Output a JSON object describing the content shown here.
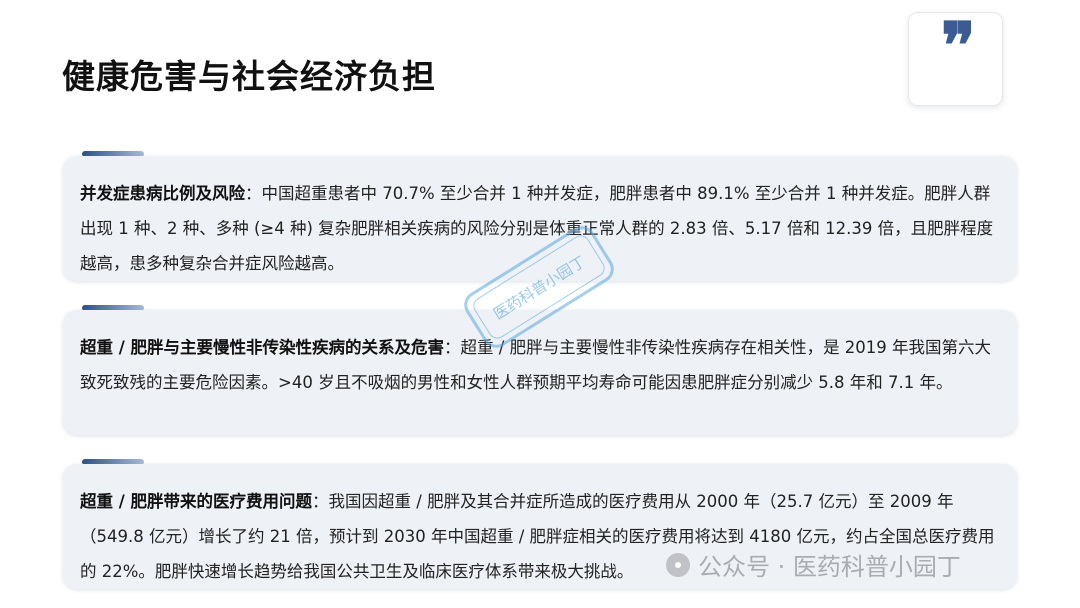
{
  "page_title": "健康危害与社会经济负担",
  "quote_symbol": "❞",
  "sections": [
    {
      "heading": "并发症患病比例及风险",
      "body": "：中国超重患者中 70.7% 至少合并 1 种并发症，肥胖患者中 89.1% 至少合并 1 种并发症。肥胖人群出现 1 种、2 种、多种 (≥4 种) 复杂肥胖相关疾病的风险分别是体重正常人群的 2.83 倍、5.17 倍和 12.39 倍，且肥胖程度越高，患多种复杂合并症风险越高。"
    },
    {
      "heading": "超重 / 肥胖与主要慢性非传染性疾病的关系及危害",
      "body": "：超重 / 肥胖与主要慢性非传染性疾病存在相关性，是 2019 年我国第六大致死致残的主要危险因素。>40 岁且不吸烟的男性和女性人群预期平均寿命可能因患肥胖症分别减少 5.8 年和 7.1 年。"
    },
    {
      "heading": "超重 / 肥胖带来的医疗费用问题",
      "body": "：我国因超重 / 肥胖及其合并症所造成的医疗费用从 2000 年（25.7 亿元）至 2009 年（549.8 亿元）增长了约 21 倍，预计到 2030 年中国超重 / 肥胖症相关的医疗费用将达到 4180 亿元，约占全国总医疗费用的 22%。肥胖快速增长趋势给我国公共卫生及临床医疗体系带来极大挑战。"
    }
  ],
  "stamp_text": "医药科普小园丁",
  "watermark": {
    "text": "公众号 · 医药科普小园丁",
    "icon": "wechat-icon"
  },
  "colors": {
    "accent": "#2e4f86",
    "card_bg": "#eef1f6",
    "stamp": "#5aa8e0"
  }
}
